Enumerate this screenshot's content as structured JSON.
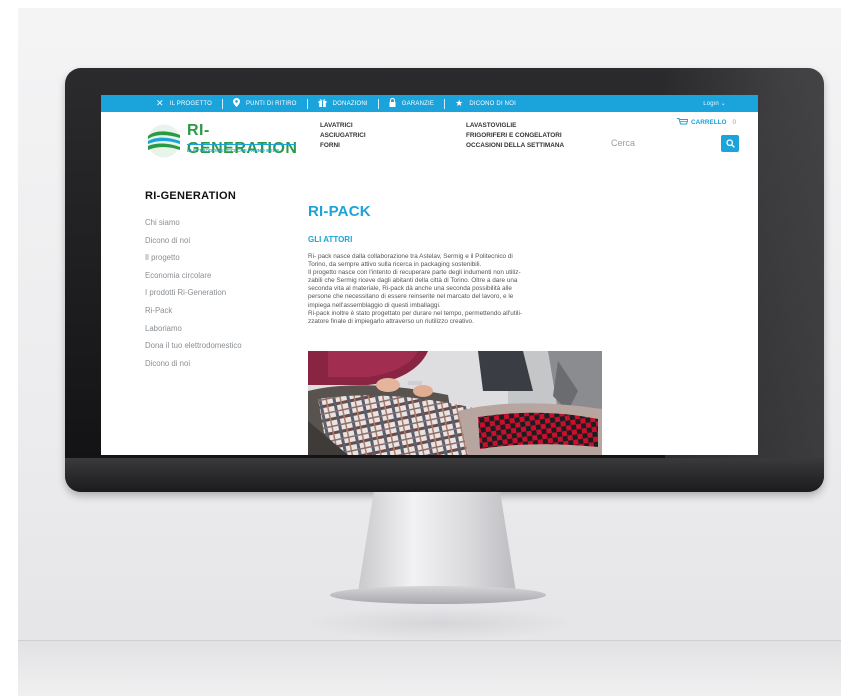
{
  "colors": {
    "accent": "#1ba3dc",
    "brand_green": "#2b9a45",
    "topbar": "#1ba3dc"
  },
  "topbar": {
    "items": [
      {
        "label": "IL PROGETTO",
        "icon": "tools-icon"
      },
      {
        "label": "PUNTI DI RITIRO",
        "icon": "location-pin-icon"
      },
      {
        "label": "DONAZIONI",
        "icon": "gift-icon"
      },
      {
        "label": "GARANZIE",
        "icon": "lock-icon"
      },
      {
        "label": "DICONO DI NOI",
        "icon": "star-icon"
      }
    ],
    "login": "Login  ⌄"
  },
  "logo": {
    "title": "RI-GENERATION",
    "subtitle": "ELETTRODOMESTICI CHE FANNO BENE"
  },
  "menu": {
    "col1": [
      "LAVATRICI",
      "ASCIUGATRICI",
      "FORNI"
    ],
    "col2": [
      "LAVASTOVIGLIE",
      "FRIGORIFERI E CONGELATORI",
      "OCCASIONI DELLA SETTIMANA"
    ]
  },
  "cart": {
    "label": "CARRELLO",
    "count": "0",
    "icon": "cart-icon"
  },
  "search": {
    "placeholder": "Cerca",
    "icon": "search-icon"
  },
  "sidebar": {
    "title": "RI-GENERATION",
    "items": [
      "Chi siamo",
      "Dicono di noi",
      "Il progetto",
      "Economia circolare",
      "I prodotti Ri-Generation",
      "Ri-Pack",
      "Laboriamo",
      "Dona il tuo elettrodomestico",
      "Dicono di noi"
    ]
  },
  "main": {
    "title": "RI-PACK",
    "subtitle": "GLI ATTORI",
    "body_lines": [
      "Ri- pack nasce dalla collaborazione tra Astelav, Sermig e il Politecnico di",
      "Torino, da sempre attivo sulla ricerca in packaging sostenibili.",
      "Il progetto nasce con l'intento di recuperare parte degli indumenti non utiliz-",
      "zabili che Sermig riceve dagli abitanti della città di Torino. Oltre a dare una",
      "seconda vita al materiale, Ri-pack dà anche una seconda possibilità alle",
      "persone che necessitano di essere reinserite nel marcato del lavoro, e le",
      "impiega nell'assemblaggio di questi imballaggi.",
      "Ri-pack inoltre è stato progettato per durare nel tempo, permettendo all'utili-",
      "zzatore finale di impiegarlo attraverso un riutilizzo creativo."
    ]
  }
}
